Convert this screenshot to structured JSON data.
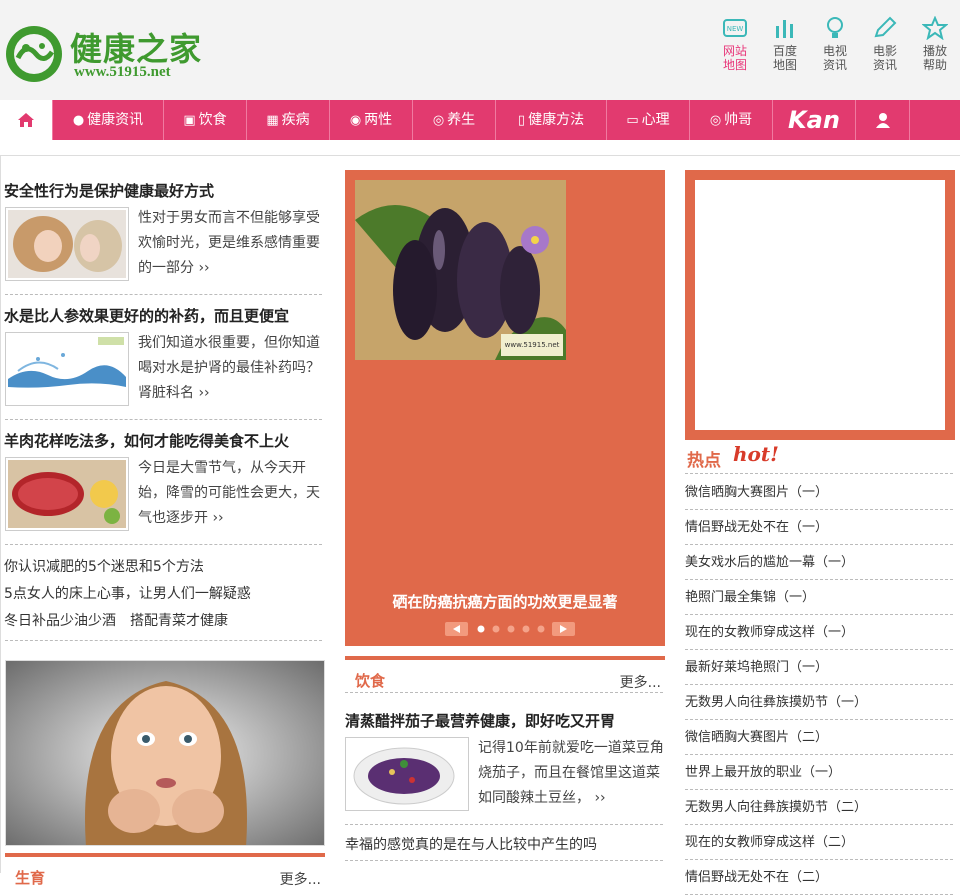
{
  "brand": {
    "title": "健康之家",
    "url": "www.51915.net"
  },
  "quick_links": [
    {
      "line1": "网站",
      "line2": "地图"
    },
    {
      "line1": "百度",
      "line2": "地图"
    },
    {
      "line1": "电视",
      "line2": "资讯"
    },
    {
      "line1": "电影",
      "line2": "资讯"
    },
    {
      "line1": "播放",
      "line2": "帮助"
    }
  ],
  "nav": [
    "健康资讯",
    "饮食",
    "疾病",
    "两性",
    "养生",
    "健康方法",
    "心理",
    "帅哥",
    "Kan"
  ],
  "left_articles": [
    {
      "title": "安全性行为是保护健康最好方式",
      "summary": "性对于男女而言不但能够享受欢愉时光，更是维系感情重要的一部分 ››"
    },
    {
      "title": "水是比人参效果更好的的补药，而且更便宜",
      "summary": "我们知道水很重要，但你知道喝对水是护肾的最佳补药吗？肾脏科名 ››"
    },
    {
      "title": "羊肉花样吃法多，如何才能吃得美食不上火",
      "summary": "今日是大雪节气，从今天开始，降雪的可能性会更大，天气也逐步开 ››"
    }
  ],
  "left_links": [
    "你认识减肥的5个迷思和5个方法",
    "5点女人的床上心事，让男人们一解疑惑",
    "冬日补品少油少酒　搭配青菜才健康"
  ],
  "left_section": {
    "title": "生育",
    "more": "更多..."
  },
  "slider": {
    "caption": "硒在防癌抗癌方面的功效更是显著",
    "watermark": "www.51915.net"
  },
  "diet_section": {
    "title": "饮食",
    "more": "更多...",
    "article_title": "清蒸醋拌茄子最营养健康，即好吃又开胃",
    "article_summary": "记得10年前就爱吃一道菜豆角烧茄子，而且在餐馆里这道菜如同酸辣土豆丝， ››",
    "link": "幸福的感觉真的是在与人比较中产生的吗"
  },
  "hot": {
    "title": "热点",
    "badge": "hot!",
    "items": [
      "微信晒胸大赛图片（一）",
      "情侣野战无处不在（一）",
      "美女戏水后的尴尬一幕（一）",
      "艳照门最全集锦（一）",
      "现在的女教师穿成这样（一）",
      "最新好莱坞艳照门（一）",
      "无数男人向往彝族摸奶节（一）",
      "微信晒胸大赛图片（二）",
      "世界上最开放的职业（一）",
      "无数男人向往彝族摸奶节（二）",
      "现在的女教师穿成这样（二）",
      "情侣野战无处不在（二）"
    ]
  },
  "colors": {
    "nav": "#e23a6f",
    "accent": "#e0694a",
    "brand": "#3f9a2f"
  }
}
